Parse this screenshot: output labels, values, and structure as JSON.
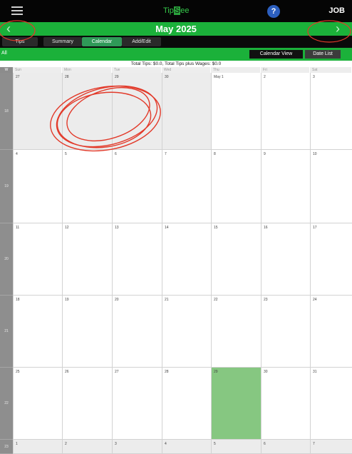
{
  "header": {
    "menu_icon": "hamburger-menu-icon",
    "logo_part1": "Tip",
    "logo_highlight": "S",
    "logo_part2": "ee",
    "help_label": "?",
    "job_label": "JOB"
  },
  "month_nav": {
    "title": "May 2025",
    "prev_label": "‹",
    "next_label": "›"
  },
  "tabs": [
    {
      "label": "Tips",
      "active": false
    },
    {
      "label": "Summary",
      "active": false
    },
    {
      "label": "Calendar",
      "active": true
    },
    {
      "label": "Add/Edit",
      "active": false
    }
  ],
  "view_bar": {
    "all_label": "All",
    "calendar_view_label": "Calendar View",
    "date_list_label": "Date List"
  },
  "totals_text": "Total Tips: $0.0,  Total Tips plus Wages: $0.0",
  "calendar": {
    "corner_label": "W",
    "weekdays": [
      "Sun",
      "Mon",
      "Tue",
      "Wed",
      "Thu",
      "Fri",
      "Sat"
    ],
    "weeks": [
      {
        "week": "18",
        "days": [
          {
            "n": "27",
            "other": true
          },
          {
            "n": "28",
            "other": true
          },
          {
            "n": "29",
            "other": true
          },
          {
            "n": "30",
            "other": true
          },
          {
            "n": "May 1"
          },
          {
            "n": "2"
          },
          {
            "n": "3"
          }
        ]
      },
      {
        "week": "19",
        "days": [
          {
            "n": "4"
          },
          {
            "n": "5"
          },
          {
            "n": "6"
          },
          {
            "n": "7"
          },
          {
            "n": "8"
          },
          {
            "n": "9"
          },
          {
            "n": "10"
          }
        ]
      },
      {
        "week": "20",
        "days": [
          {
            "n": "11"
          },
          {
            "n": "12"
          },
          {
            "n": "13"
          },
          {
            "n": "14"
          },
          {
            "n": "15"
          },
          {
            "n": "16"
          },
          {
            "n": "17"
          }
        ]
      },
      {
        "week": "21",
        "days": [
          {
            "n": "18"
          },
          {
            "n": "19"
          },
          {
            "n": "20"
          },
          {
            "n": "21"
          },
          {
            "n": "22"
          },
          {
            "n": "23"
          },
          {
            "n": "24"
          }
        ]
      },
      {
        "week": "22",
        "days": [
          {
            "n": "25"
          },
          {
            "n": "26"
          },
          {
            "n": "27"
          },
          {
            "n": "28"
          },
          {
            "n": "29",
            "today": true
          },
          {
            "n": "30"
          },
          {
            "n": "31"
          }
        ]
      },
      {
        "week": "23",
        "days": [
          {
            "n": "1",
            "other": true
          },
          {
            "n": "2",
            "other": true
          },
          {
            "n": "3",
            "other": true
          },
          {
            "n": "4",
            "other": true
          },
          {
            "n": "5",
            "other": true
          },
          {
            "n": "6",
            "other": true
          },
          {
            "n": "7",
            "other": true
          }
        ]
      }
    ]
  },
  "colors": {
    "accent_green": "#1bb13a",
    "today_green": "#86c781",
    "annotation_red": "#e23a2a"
  }
}
